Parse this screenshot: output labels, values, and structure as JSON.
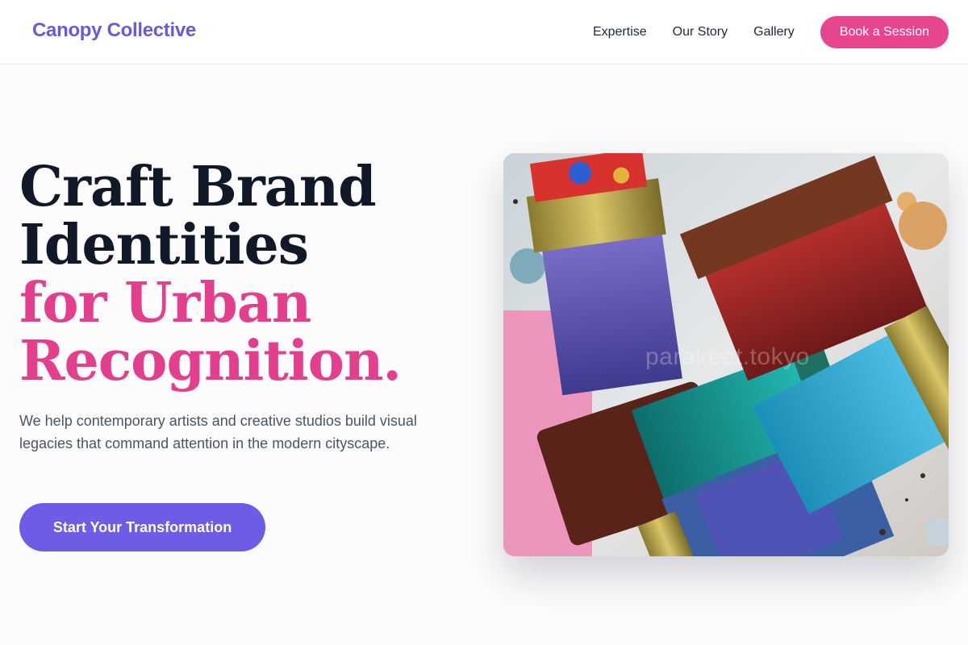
{
  "header": {
    "brand": "Canopy Collective",
    "nav": [
      {
        "label": "Expertise"
      },
      {
        "label": "Our Story"
      },
      {
        "label": "Gallery"
      }
    ],
    "cta_label": "Book a Session"
  },
  "hero": {
    "title_lines": [
      "Craft Brand",
      "Identities",
      "for Urban",
      "Recognition."
    ],
    "subtitle": "We help contemporary artists and creative studios build visual legacies that command attention in the modern cityscape.",
    "cta_label": "Start Your Transformation",
    "image_watermark": "parakeet.tokyo"
  },
  "colors": {
    "brand": "#6b5ad8",
    "accent_pink": "#e8458f",
    "accent_purple": "#6d5ce6",
    "heading": "#111827",
    "body_text": "#4b5563"
  }
}
